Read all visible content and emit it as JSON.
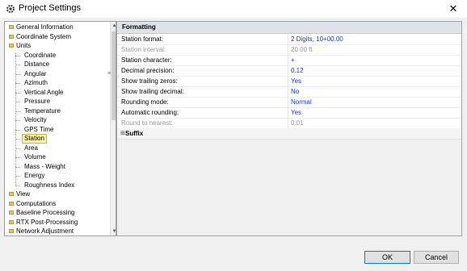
{
  "window": {
    "title": "Project Settings",
    "close_glyph": "✕"
  },
  "tree": {
    "items": [
      {
        "label": "General Information",
        "type": "folder"
      },
      {
        "label": "Coordinate System",
        "type": "folder"
      },
      {
        "label": "Units",
        "type": "folder"
      },
      {
        "label": "Coordinate",
        "type": "leaf"
      },
      {
        "label": "Distance",
        "type": "leaf"
      },
      {
        "label": "Angular",
        "type": "leaf"
      },
      {
        "label": "Azimuth",
        "type": "leaf"
      },
      {
        "label": "Vertical Angle",
        "type": "leaf"
      },
      {
        "label": "Pressure",
        "type": "leaf"
      },
      {
        "label": "Temperature",
        "type": "leaf"
      },
      {
        "label": "Velocity",
        "type": "leaf"
      },
      {
        "label": "GPS Time",
        "type": "leaf"
      },
      {
        "label": "Station",
        "type": "leaf",
        "selected": true
      },
      {
        "label": "Area",
        "type": "leaf"
      },
      {
        "label": "Volume",
        "type": "leaf"
      },
      {
        "label": "Mass - Weight",
        "type": "leaf"
      },
      {
        "label": "Energy",
        "type": "leaf"
      },
      {
        "label": "Roughness Index",
        "type": "leaf"
      },
      {
        "label": "View",
        "type": "folder"
      },
      {
        "label": "Computations",
        "type": "folder"
      },
      {
        "label": "Baseline Processing",
        "type": "folder"
      },
      {
        "label": "RTX Post-Processing",
        "type": "folder"
      },
      {
        "label": "Network Adjustment",
        "type": "folder"
      }
    ]
  },
  "grid": {
    "section": "Formatting",
    "rows": [
      {
        "name": "Station format:",
        "value": "2 Digits, 10+00.00",
        "disabled": false
      },
      {
        "name": "Station interval:",
        "value": "20.00 ft",
        "disabled": true
      },
      {
        "name": "Station character:",
        "value": "+",
        "disabled": false
      },
      {
        "name": "Decimal precision:",
        "value": "0.12",
        "disabled": false
      },
      {
        "name": "Show trailing zeros:",
        "value": "Yes",
        "disabled": false
      },
      {
        "name": "Show trailing decimal:",
        "value": "No",
        "disabled": false
      },
      {
        "name": "Rounding mode:",
        "value": "Normal",
        "disabled": false
      },
      {
        "name": "Automatic rounding:",
        "value": "Yes",
        "disabled": false
      },
      {
        "name": "Round to nearest:",
        "value": "0.01",
        "disabled": true
      }
    ],
    "suffix_section": "Suffix",
    "suffix_toggle": "⊞"
  },
  "buttons": {
    "ok": "OK",
    "cancel": "Cancel"
  },
  "scroll": {
    "up": "▲",
    "down": "▼",
    "splitter": "≡"
  },
  "colors": {
    "value_text": "#1a36c9",
    "selected_bg": "#fdf3a7",
    "folder": "#dcc46a"
  }
}
